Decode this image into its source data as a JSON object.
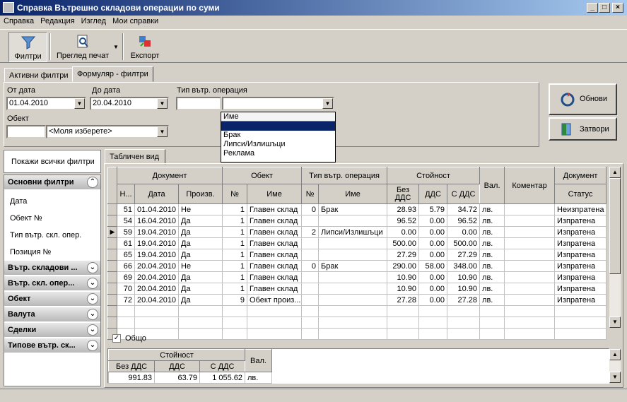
{
  "window": {
    "title": "Справка Вътрешно складови операции по суми"
  },
  "menu": [
    "Справка",
    "Редакция",
    "Изглед",
    "Мои справки"
  ],
  "toolbar": {
    "filters": "Филтри",
    "preview": "Преглед печат",
    "export": "Експорт"
  },
  "tabs": {
    "active_filters": "Активни филтри",
    "form_filters": "Формуляр - филтри"
  },
  "form": {
    "from_date_label": "От дата",
    "from_date": "01.04.2010",
    "to_date_label": "До дата",
    "to_date": "20.04.2010",
    "op_type_label": "Тип вътр. операция",
    "object_label": "Обект",
    "object_value": "<Моля изберете>"
  },
  "dropdown": {
    "header": "Име",
    "items": [
      "",
      "Брак",
      "Липси/Излишъци",
      "Реклама"
    ]
  },
  "buttons": {
    "refresh": "Обнови",
    "close": "Затвори"
  },
  "sidebar": {
    "show_all": "Покажи всички филтри",
    "main_group": "Основни филтри",
    "main_items": [
      "Дата",
      "Обект №",
      "Тип вътр. скл. опер.",
      "Позиция №"
    ],
    "groups": [
      "Вътр. складови ...",
      "Вътр. скл. опер...",
      "Обект",
      "Валута",
      "Сделки",
      "Типове вътр. ск..."
    ]
  },
  "grid_tab": "Табличен вид",
  "grid": {
    "group_headers": {
      "document": "Документ",
      "object": "Обект",
      "op_type": "Тип вътр. операция",
      "value": "Стойност",
      "currency": "Вал.",
      "comment": "Коментар",
      "doc2": "Документ"
    },
    "headers": [
      "Н...",
      "Дата",
      "Произв.",
      "№",
      "Име",
      "№",
      "Име",
      "Без ДДС",
      "ДДС",
      "С ДДС",
      "Статус"
    ],
    "rows": [
      [
        "51",
        "01.04.2010",
        "Не",
        "1",
        "Главен склад",
        "0",
        "Брак",
        "28.93",
        "5.79",
        "34.72",
        "лв.",
        "",
        "Неизпратена"
      ],
      [
        "54",
        "16.04.2010",
        "Да",
        "1",
        "Главен склад",
        "",
        "",
        "96.52",
        "0.00",
        "96.52",
        "лв.",
        "",
        "Изпратена"
      ],
      [
        "59",
        "19.04.2010",
        "Да",
        "1",
        "Главен склад",
        "2",
        "Липси/Излишъци",
        "0.00",
        "0.00",
        "0.00",
        "лв.",
        "",
        "Изпратена"
      ],
      [
        "61",
        "19.04.2010",
        "Да",
        "1",
        "Главен склад",
        "",
        "",
        "500.00",
        "0.00",
        "500.00",
        "лв.",
        "",
        "Изпратена"
      ],
      [
        "65",
        "19.04.2010",
        "Да",
        "1",
        "Главен склад",
        "",
        "",
        "27.29",
        "0.00",
        "27.29",
        "лв.",
        "",
        "Изпратена"
      ],
      [
        "66",
        "20.04.2010",
        "Не",
        "1",
        "Главен склад",
        "0",
        "Брак",
        "290.00",
        "58.00",
        "348.00",
        "лв.",
        "",
        "Изпратена"
      ],
      [
        "69",
        "20.04.2010",
        "Да",
        "1",
        "Главен склад",
        "",
        "",
        "10.90",
        "0.00",
        "10.90",
        "лв.",
        "",
        "Изпратена"
      ],
      [
        "70",
        "20.04.2010",
        "Да",
        "1",
        "Главен склад",
        "",
        "",
        "10.90",
        "0.00",
        "10.90",
        "лв.",
        "",
        "Изпратена"
      ],
      [
        "72",
        "20.04.2010",
        "Да",
        "9",
        "Обект произ...",
        "",
        "",
        "27.28",
        "0.00",
        "27.28",
        "лв.",
        "",
        "Изпратена"
      ]
    ],
    "current_row_index": 2
  },
  "totals": {
    "checkbox_label": "Общо",
    "value_header": "Стойност",
    "currency_header": "Вал.",
    "headers": [
      "Без ДДС",
      "ДДС",
      "С ДДС"
    ],
    "values": [
      "991.83",
      "63.79",
      "1 055.62",
      "лв."
    ]
  }
}
